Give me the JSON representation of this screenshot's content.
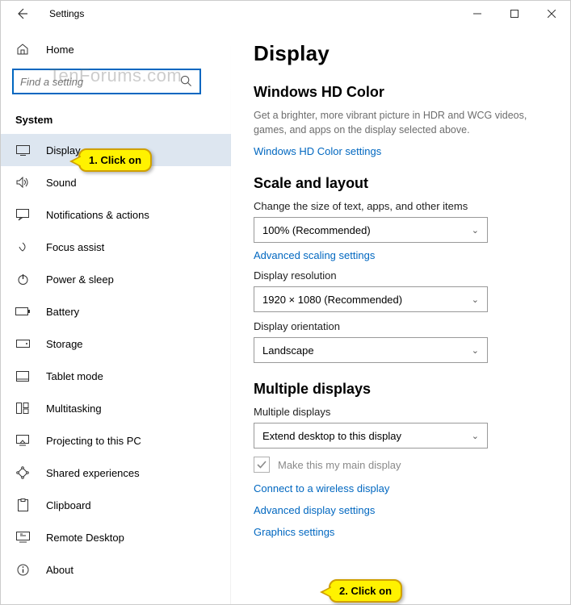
{
  "window": {
    "title": "Settings"
  },
  "watermark": "TenForums.com",
  "sidebar": {
    "home": "Home",
    "search_placeholder": "Find a setting",
    "section_label": "System",
    "items": [
      {
        "label": "Display",
        "selected": true
      },
      {
        "label": "Sound"
      },
      {
        "label": "Notifications & actions"
      },
      {
        "label": "Focus assist"
      },
      {
        "label": "Power & sleep"
      },
      {
        "label": "Battery"
      },
      {
        "label": "Storage"
      },
      {
        "label": "Tablet mode"
      },
      {
        "label": "Multitasking"
      },
      {
        "label": "Projecting to this PC"
      },
      {
        "label": "Shared experiences"
      },
      {
        "label": "Clipboard"
      },
      {
        "label": "Remote Desktop"
      },
      {
        "label": "About"
      }
    ]
  },
  "content": {
    "page_title": "Display",
    "hd_color": {
      "title": "Windows HD Color",
      "desc": "Get a brighter, more vibrant picture in HDR and WCG videos, games, and apps on the display selected above.",
      "link": "Windows HD Color settings"
    },
    "scale": {
      "title": "Scale and layout",
      "size_label": "Change the size of text, apps, and other items",
      "size_value": "100% (Recommended)",
      "adv_scaling_link": "Advanced scaling settings",
      "resolution_label": "Display resolution",
      "resolution_value": "1920 × 1080 (Recommended)",
      "orientation_label": "Display orientation",
      "orientation_value": "Landscape"
    },
    "multi": {
      "title": "Multiple displays",
      "multi_label": "Multiple displays",
      "multi_value": "Extend desktop to this display",
      "main_display_chk": "Make this my main display",
      "connect_link": "Connect to a wireless display",
      "advanced_link": "Advanced display settings",
      "graphics_link": "Graphics settings"
    }
  },
  "callouts": {
    "c1": "1. Click on",
    "c2": "2. Click on"
  }
}
